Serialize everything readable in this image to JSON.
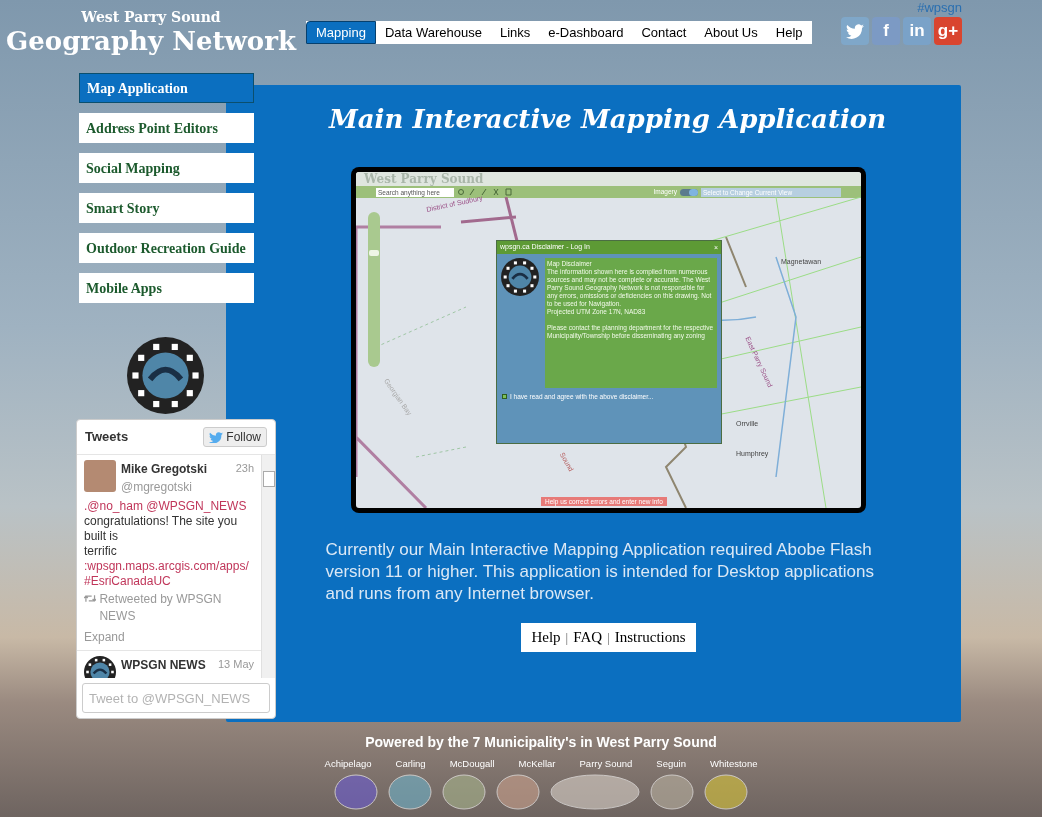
{
  "site": {
    "subtitle": "West Parry Sound",
    "title": "Geography Network"
  },
  "hashtag": "#wpsgn",
  "nav": [
    {
      "label": "Mapping",
      "selected": true
    },
    {
      "label": "Data Warehouse",
      "selected": false
    },
    {
      "label": "Links",
      "selected": false
    },
    {
      "label": "e-Dashboard",
      "selected": false
    },
    {
      "label": "Contact",
      "selected": false
    },
    {
      "label": "About Us",
      "selected": false
    },
    {
      "label": "Help",
      "selected": false
    }
  ],
  "social": [
    {
      "kind": "twitter"
    },
    {
      "kind": "facebook",
      "glyph": "f"
    },
    {
      "kind": "linkedin",
      "glyph": "in"
    },
    {
      "kind": "googleplus",
      "glyph": "g+"
    }
  ],
  "side_menu": [
    {
      "label": "Map Application",
      "selected": true
    },
    {
      "label": "Address Point Editors",
      "selected": false
    },
    {
      "label": "Social Mapping",
      "selected": false
    },
    {
      "label": "Smart Story",
      "selected": false
    },
    {
      "label": "Outdoor Recreation Guide",
      "selected": false
    },
    {
      "label": "Mobile Apps",
      "selected": false
    }
  ],
  "main": {
    "heading": "Main Interactive Mapping Application",
    "app_screenshot": {
      "brand": "West Parry Sound",
      "search_placeholder": "Search anything here",
      "imagery_label": "Imagery",
      "imagery_on": true,
      "zoom_slider": {
        "level": 0.75
      },
      "view_select": "Select to Change Current View",
      "map_labels": [
        "District of Sudbury",
        "Georgian Bay",
        "Sound",
        "East Parry Sound",
        "Magnetawan",
        "Humphrey",
        "Orrville"
      ],
      "dialog": {
        "title": "wpsgn.ca Disclaimer - Log In",
        "close": "×",
        "heading": "Map Disclaimer",
        "body": "The information shown here is compiled from numerous sources and may not be complete or accurate.  The West Parry Sound Geography Network is not responsible for any errors, omissions or deficiencies on this drawing.  Not to be used for Navigation.\nProjected UTM Zone 17N, NAD83\n\nPlease contact the planning department for the respective Municipality/Township before disseminating any zoning",
        "agree_label": "I have read and agree with the above disclaimer...",
        "agree_checked": false
      },
      "report_button": "Help us correct errors and enter new info"
    },
    "description": "Currently our Main Interactive Mapping Application required Abobe Flash version 11 or higher.  This application is intended for Desktop applications and runs from any Internet browser.",
    "help_links": [
      {
        "kind": "link",
        "text": "Help"
      },
      {
        "kind": "separator",
        "text": "|"
      },
      {
        "kind": "link",
        "text": "FAQ"
      },
      {
        "kind": "separator",
        "text": "|"
      },
      {
        "kind": "link",
        "text": "Instructions"
      }
    ]
  },
  "tweets": {
    "title": "Tweets",
    "follow": "Follow",
    "items": [
      {
        "name": "Mike Gregotski",
        "time": "23h",
        "handle": "@mgregotski",
        "kind": "person",
        "segments": [
          {
            "kind": "link",
            "text": ".@no_ham @WPSGN_NEWS"
          },
          {
            "kind": "text",
            "text": " congratulations!  The site you built is\nterrific"
          },
          {
            "kind": "link",
            "text": ":wpsgn.maps.arcgis.com/apps/"
          },
          {
            "kind": "link",
            "text": " #EsriCanadaUC"
          }
        ],
        "retweet": "Retweeted by WPSGN NEWS",
        "expand": "Expand"
      },
      {
        "name": "WPSGN NEWS",
        "time": "13 May",
        "kind": "account"
      }
    ],
    "input_placeholder": "Tweet to @WPSGN_NEWS"
  },
  "footer": {
    "powered_by": "Powered by the 7 Municipality's in West Parry Sound",
    "municipalities": [
      "Achipelago",
      "Carling",
      "McDougall",
      "McKellar",
      "Parry Sound",
      "Seguin",
      "Whitestone"
    ]
  }
}
